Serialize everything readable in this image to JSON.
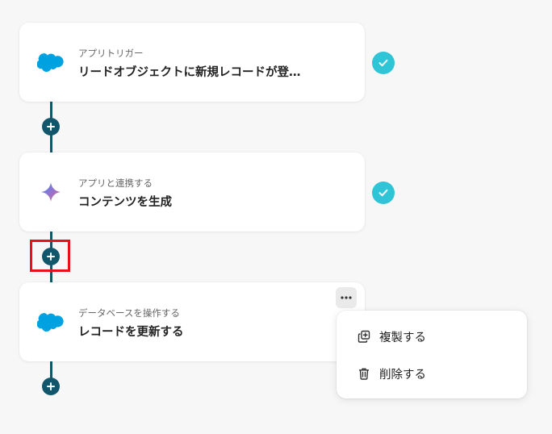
{
  "steps": [
    {
      "subtitle": "アプリトリガー",
      "title": "リードオブジェクトに新規レコードが登…",
      "icon": "salesforce-cloud-icon",
      "status": "completed"
    },
    {
      "subtitle": "アプリと連携する",
      "title": "コンテンツを生成",
      "icon": "gemini-sparkle-icon",
      "status": "completed"
    },
    {
      "subtitle": "データベースを操作する",
      "title": "レコードを更新する",
      "icon": "salesforce-cloud-icon",
      "status": "editing"
    }
  ],
  "context_menu": {
    "items": [
      {
        "label": "複製する",
        "icon": "duplicate-icon"
      },
      {
        "label": "削除する",
        "icon": "trash-icon"
      }
    ]
  },
  "colors": {
    "flow_line": "#12566b",
    "check_badge": "#2fc4d6",
    "salesforce": "#00a1e0",
    "highlight": "#e8101b"
  }
}
